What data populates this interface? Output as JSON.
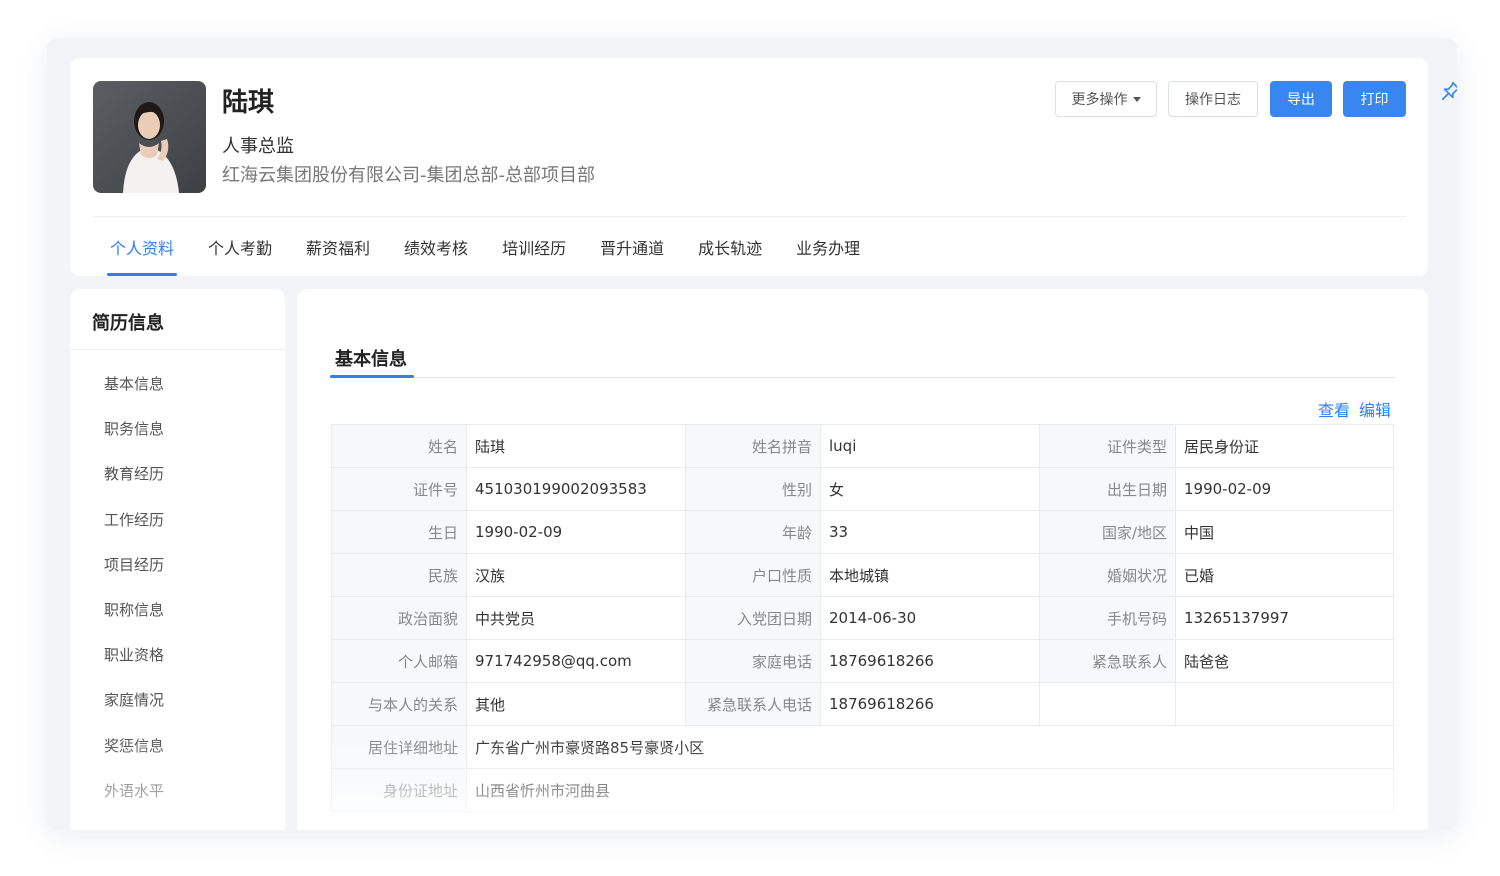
{
  "profile": {
    "name": "陆琪",
    "title": "人事总监",
    "org": "红海云集团股份有限公司-集团总部-总部项目部"
  },
  "toolbar": {
    "more_label": "更多操作",
    "log_label": "操作日志",
    "export_label": "导出",
    "print_label": "打印"
  },
  "tabs": [
    "个人资料",
    "个人考勤",
    "薪资福利",
    "绩效考核",
    "培训经历",
    "晋升通道",
    "成长轨迹",
    "业务办理"
  ],
  "sidebar": {
    "title": "简历信息",
    "items": [
      "基本信息",
      "职务信息",
      "教育经历",
      "工作经历",
      "项目经历",
      "职称信息",
      "职业资格",
      "家庭情况",
      "奖惩信息",
      "外语水平"
    ]
  },
  "section": {
    "title": "基本信息",
    "view_label": "查看",
    "edit_label": "编辑"
  },
  "fields": {
    "r1": [
      "姓名",
      "陆琪",
      "姓名拼音",
      "luqi",
      "证件类型",
      "居民身份证"
    ],
    "r2": [
      "证件号",
      "451030199002093583",
      "性别",
      "女",
      "出生日期",
      "1990-02-09"
    ],
    "r3": [
      "生日",
      "1990-02-09",
      "年龄",
      "33",
      "国家/地区",
      "中国"
    ],
    "r4": [
      "民族",
      "汉族",
      "户口性质",
      "本地城镇",
      "婚姻状况",
      "已婚"
    ],
    "r5": [
      "政治面貌",
      "中共党员",
      "入党团日期",
      "2014-06-30",
      "手机号码",
      "13265137997"
    ],
    "r6": [
      "个人邮箱",
      "971742958@qq.com",
      "家庭电话",
      "18769618266",
      "紧急联系人",
      "陆爸爸"
    ],
    "r7": [
      "与本人的关系",
      "其他",
      "紧急联系人电话",
      "18769618266"
    ],
    "r8": [
      "居住详细地址",
      "广东省广州市豪贤路85号豪贤小区"
    ],
    "r9": [
      "身份证地址",
      "山西省忻州市河曲县"
    ]
  },
  "colors": {
    "accent": "#2f7ff0",
    "primary_button": "#3a86f0"
  }
}
